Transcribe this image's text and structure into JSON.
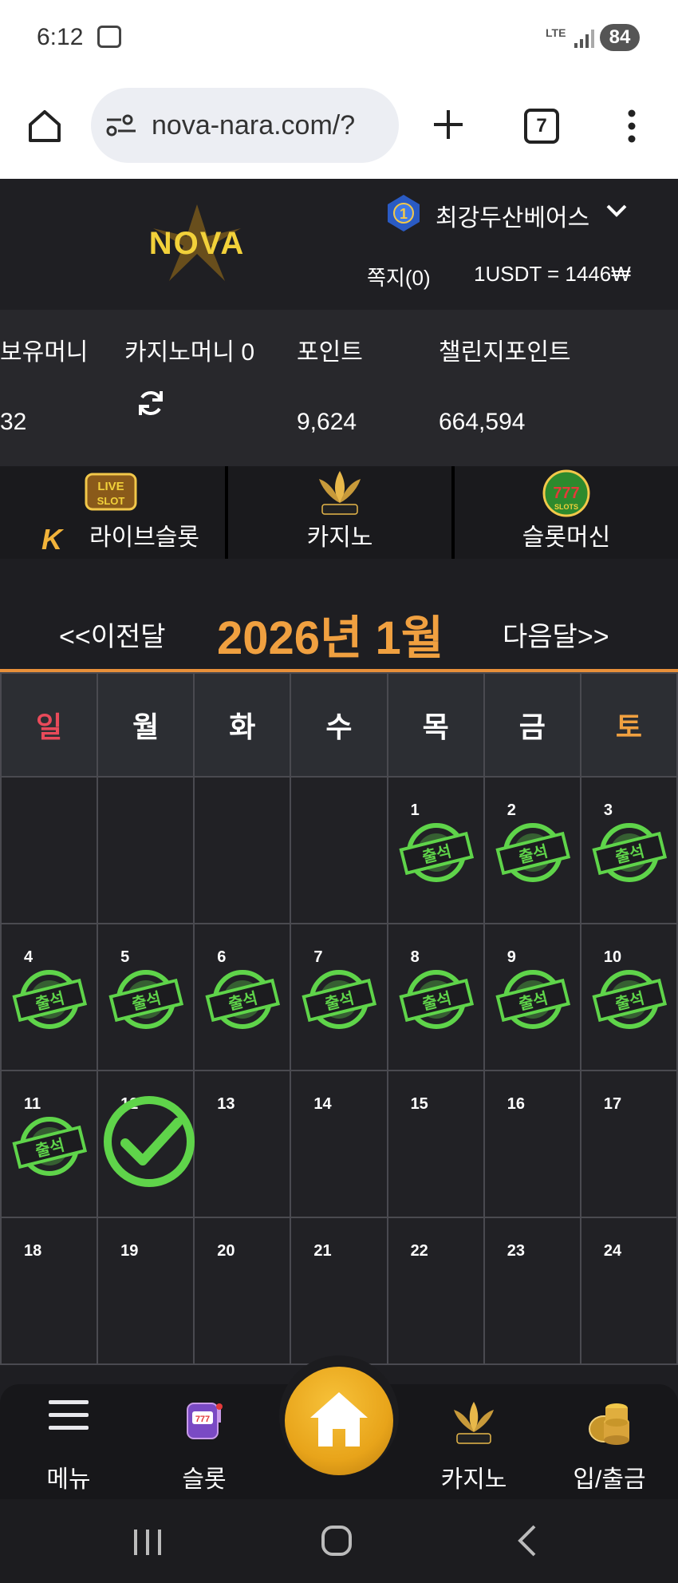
{
  "status_bar": {
    "time": "6:12",
    "network": "LTE",
    "battery": "84"
  },
  "browser": {
    "url": "nova-nara.com/?",
    "tab_count": "7"
  },
  "site": {
    "logo_text": "NOVA",
    "username": "최강두산베어스",
    "memo": "쪽지(0)",
    "exchange_rate": "1USDT = 1446₩"
  },
  "balances": {
    "holding_label": "보유머니",
    "holding_value": "32",
    "casino_label": "카지노머니 0",
    "point_label": "포인트",
    "point_value": "9,624",
    "challenge_label": "챌린지포인트",
    "challenge_value": "664,594"
  },
  "game_nav": {
    "live_slot": "라이브슬롯",
    "live_slot_badge": "LIVE SLOT",
    "casino": "카지노",
    "slot_machine": "슬롯머신"
  },
  "calendar": {
    "prev": "<<이전달",
    "title": "2026년 1월",
    "next": "다음달>>",
    "weekdays": [
      "일",
      "월",
      "화",
      "수",
      "목",
      "금",
      "토"
    ],
    "stamp_text": "출석",
    "attended_days": [
      1,
      2,
      3,
      4,
      5,
      6,
      7,
      8,
      9,
      10,
      11
    ],
    "today": 12
  },
  "bottom_nav": {
    "menu": "메뉴",
    "slot": "슬롯",
    "casino": "카지노",
    "deposit": "입/출금"
  },
  "colors": {
    "accent_orange": "#f0a040",
    "sunday_red": "#e94a5a",
    "stamp_green": "#5fd44a"
  }
}
